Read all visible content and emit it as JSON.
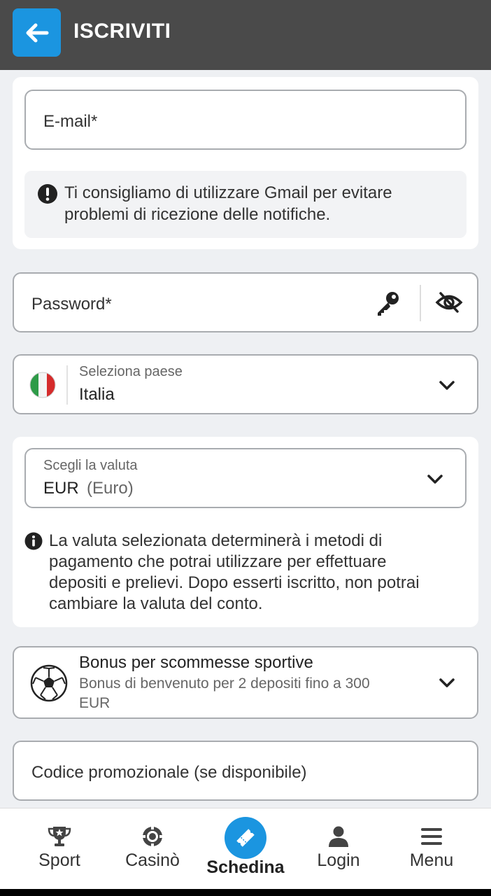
{
  "header": {
    "title": "ISCRIVITI",
    "back_icon": "arrow-left-icon"
  },
  "email": {
    "label": "E-mail*",
    "value": ""
  },
  "gmail_note": {
    "text_line1": "Ti consigliamo di utilizzare Gmail per evitare",
    "text_line2": "problemi di ricezione delle notifiche."
  },
  "password": {
    "label": "Password*",
    "value": ""
  },
  "country": {
    "label": "Seleziona paese",
    "value": "Italia"
  },
  "currency": {
    "label": "Scegli la valuta",
    "code": "EUR",
    "name": "(Euro)"
  },
  "currency_note": {
    "line1": "La valuta selezionata determinerà i metodi di",
    "line2": "pagamento che potrai utilizzare per effettuare",
    "line3": "depositi e prelievi. Dopo esserti iscritto, non potrai",
    "line4": "cambiare la valuta del conto."
  },
  "bonus": {
    "title": "Bonus per scommesse sportive",
    "desc_line1": "Bonus di benvenuto per 2 depositi fino a 300",
    "desc_line2": "EUR"
  },
  "promo": {
    "label": "Codice promozionale (se disponibile)",
    "value": ""
  },
  "nav": {
    "items": [
      {
        "label": "Sport",
        "icon": "trophy-icon"
      },
      {
        "label": "Casinò",
        "icon": "chip-icon"
      },
      {
        "label": "Schedina",
        "icon": "ticket-icon"
      },
      {
        "label": "Login",
        "icon": "user-icon"
      },
      {
        "label": "Menu",
        "icon": "menu-icon"
      }
    ],
    "active": "Schedina"
  },
  "colors": {
    "accent": "#1b95e0",
    "header_bg": "#4a4a4a"
  }
}
